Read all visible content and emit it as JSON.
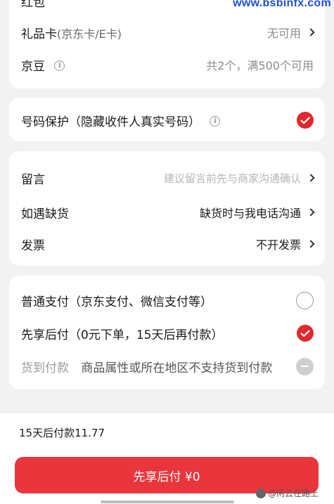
{
  "watermark": "www.bsbinfx.com",
  "benefits": {
    "hongbao_label": "红包",
    "giftcard_label": "礼品卡",
    "giftcard_sub": "(京东卡/E卡)",
    "giftcard_value": "无可用",
    "jingdou_label": "京豆",
    "jingdou_value": "共2个，满500个可用"
  },
  "privacy": {
    "label": "号码保护（隐藏收件人真实号码）",
    "checked": true
  },
  "order_options": {
    "note_label": "留言",
    "note_placeholder": "建议留言前先与商家沟通确认",
    "stockout_label": "如遇缺货",
    "stockout_value": "缺货时与我电话沟通",
    "invoice_label": "发票",
    "invoice_value": "不开发票"
  },
  "payment": {
    "normal_label": "普通支付（京东支付、微信支付等）",
    "paylater_label": "先享后付（0元下单，15天后再付款）",
    "cod_label": "货到付款",
    "cod_note": "商品属性或所在地区不支持货到付款",
    "selected": "paylater"
  },
  "footer": {
    "pay_later_amount": "15天后付款11.77",
    "submit_label": "先享后付 ¥0",
    "corner_mark": "@闲云在路上"
  },
  "colors": {
    "accent": "#e0282d",
    "button": "#e8363c"
  }
}
